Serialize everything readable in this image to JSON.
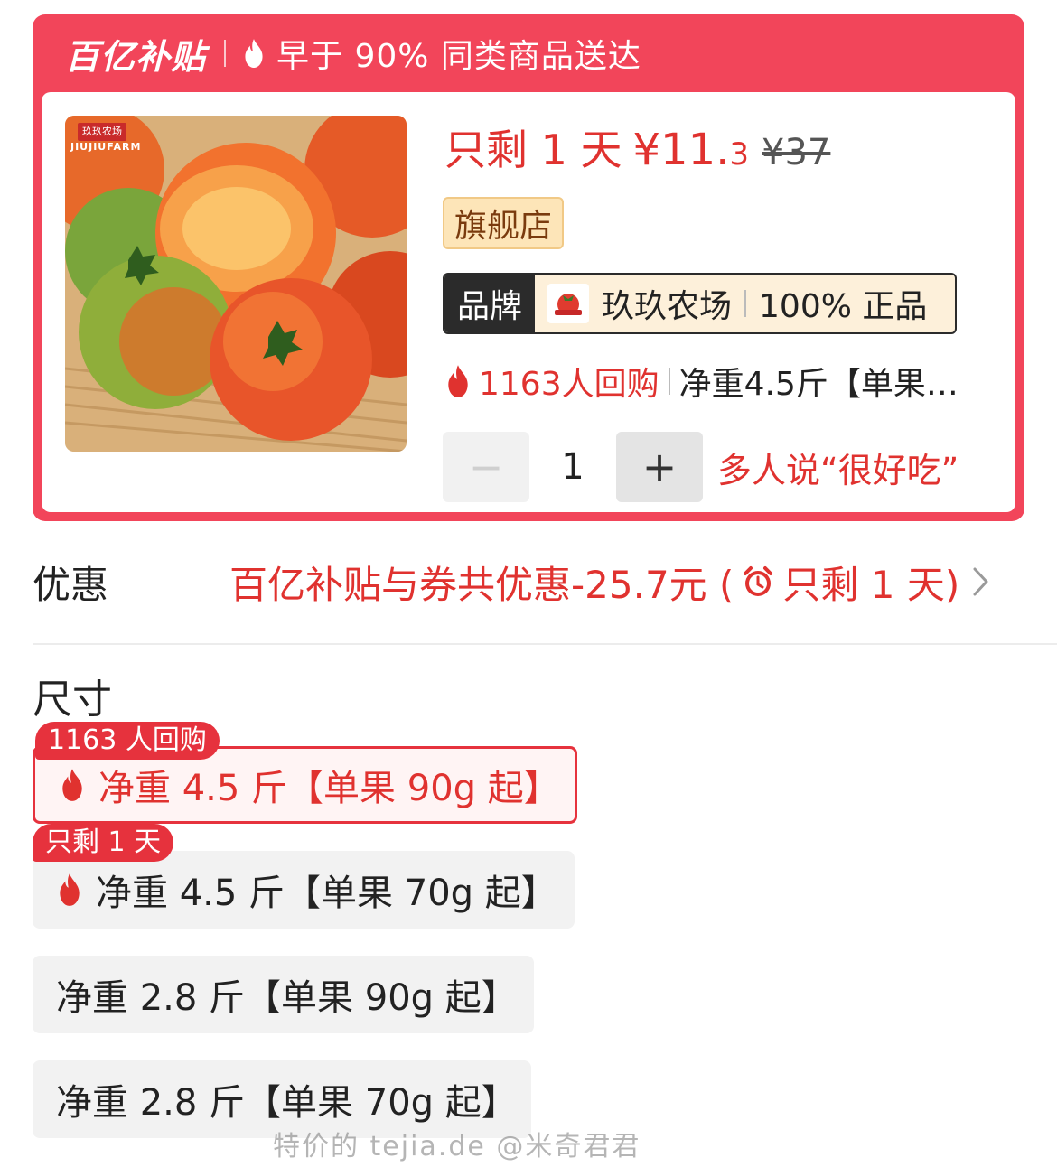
{
  "header": {
    "logo_text": "百亿补贴",
    "delivery_text": "早于 90% 同类商品送达"
  },
  "product": {
    "image_badge_cn": "玖玖农场",
    "image_badge_en": "JIUJIUFARM",
    "remain_text": "只剩 1 天",
    "price_main": "¥11.",
    "price_decimal": "3",
    "original_price": "¥37",
    "store_badge": "旗舰店",
    "brand_label": "品牌",
    "brand_name": "玖玖农场",
    "brand_auth": "100% 正品",
    "repurchase_text": "1163人回购",
    "spec_preview": "净重4.5斤【单果…",
    "quantity": "1",
    "qty_minus": "−",
    "qty_plus": "+",
    "tag_text": "多人说“很好吃”"
  },
  "discount": {
    "label": "优惠",
    "text_before": "百亿补贴与券共优惠-25.7元 (",
    "text_after": "只剩 1 天)"
  },
  "size": {
    "title": "尺寸",
    "options": [
      {
        "badge": "1163 人回购",
        "label": "净重 4.5 斤【单果 90g 起】"
      },
      {
        "badge": "只剩 1 天",
        "label": "净重 4.5 斤【单果 70g 起】"
      },
      {
        "label": "净重 2.8 斤【单果 90g 起】"
      },
      {
        "label": "净重 2.8 斤【单果 70g 起】"
      }
    ]
  },
  "watermark": "特价的 tejia.de @米奇君君",
  "colors": {
    "brand_red": "#f2455a",
    "accent_red": "#e0322f",
    "store_badge_bg": "#fde5b8"
  }
}
